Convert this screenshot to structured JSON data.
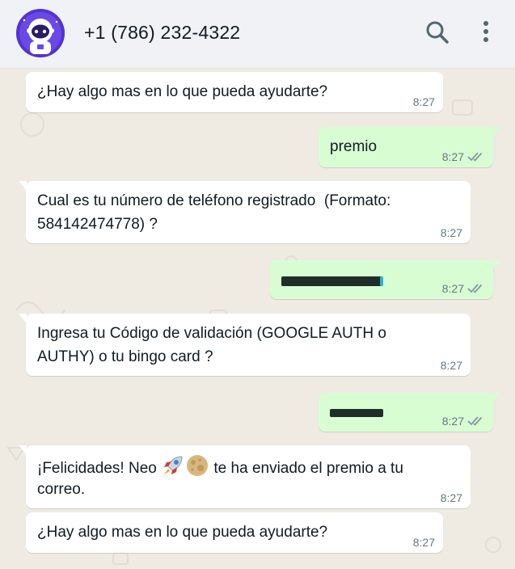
{
  "header": {
    "contact_name": "+1 (786) 232-4322",
    "avatar_icon": "astronaut-icon",
    "search_icon": "search-icon",
    "menu_icon": "more-vertical-icon"
  },
  "colors": {
    "header_bg": "#f0f2f5",
    "chat_bg": "#efeae2",
    "incoming_bubble": "#ffffff",
    "outgoing_bubble": "#d9fdd3",
    "read_tick": "#8696a0"
  },
  "messages": [
    {
      "direction": "incoming",
      "text": "¿Hay algo mas en lo que pueda ayudarte?",
      "time": "8:27"
    },
    {
      "direction": "outgoing",
      "text": "premio",
      "time": "8:27",
      "status": "read"
    },
    {
      "direction": "incoming",
      "line1": "Cual es tu número de teléfono registrado  (Formato:",
      "line2": "584142474778) ?",
      "time": "8:27"
    },
    {
      "direction": "outgoing",
      "text": "[redacted phone number]",
      "time": "8:27",
      "status": "read",
      "redacted": true
    },
    {
      "direction": "incoming",
      "line1": "Ingresa tu Código de validación (GOOGLE AUTH o",
      "line2": "AUTHY) o tu bingo card ?",
      "time": "8:27"
    },
    {
      "direction": "outgoing",
      "text": "[redacted code]",
      "time": "8:27",
      "status": "read",
      "redacted": true
    },
    {
      "direction": "incoming",
      "line1_a": "¡Felicidades! Neo ",
      "emoji1": "rocket-emoji",
      "emoji2": "moon-emoji",
      "line1_b": " te ha enviado el premio a tu",
      "line2": "correo.",
      "time": "8:27"
    },
    {
      "direction": "incoming",
      "text": "¿Hay algo mas en lo que pueda ayudarte?",
      "time": "8:27"
    }
  ]
}
